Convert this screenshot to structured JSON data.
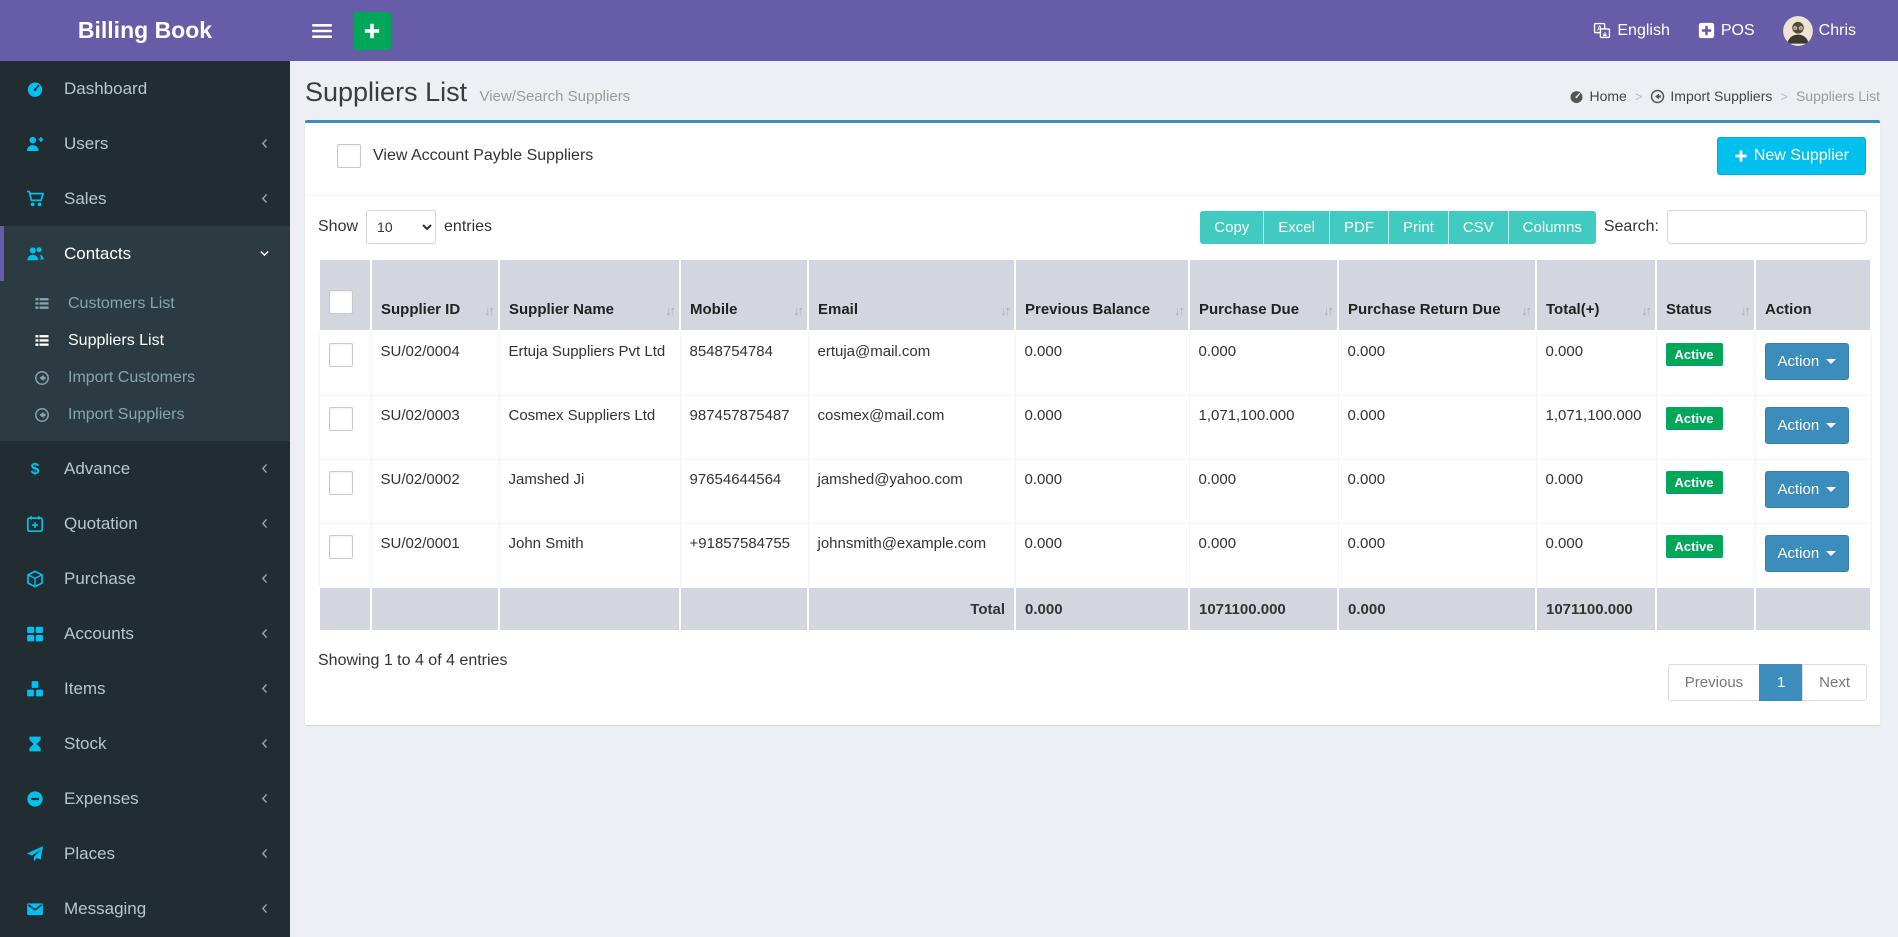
{
  "navbar": {
    "brand": "Billing Book",
    "language_label": "English",
    "pos_label": "POS",
    "user_name": "Chris"
  },
  "sidebar": {
    "items": [
      {
        "label": "Dashboard",
        "icon": "dashboard-icon"
      },
      {
        "label": "Users",
        "icon": "user-plus-icon"
      },
      {
        "label": "Sales",
        "icon": "cart-icon"
      },
      {
        "label": "Contacts",
        "icon": "users-icon"
      },
      {
        "label": "Advance",
        "icon": "dollar-icon"
      },
      {
        "label": "Quotation",
        "icon": "calendar-plus-icon"
      },
      {
        "label": "Purchase",
        "icon": "cube-icon"
      },
      {
        "label": "Accounts",
        "icon": "grid-icon"
      },
      {
        "label": "Items",
        "icon": "cubes-icon"
      },
      {
        "label": "Stock",
        "icon": "hourglass-icon"
      },
      {
        "label": "Expenses",
        "icon": "minus-circle-icon"
      },
      {
        "label": "Places",
        "icon": "paper-plane-icon"
      },
      {
        "label": "Messaging",
        "icon": "envelope-icon"
      }
    ],
    "submenu": [
      {
        "label": "Customers List",
        "icon": "list-icon",
        "active": false
      },
      {
        "label": "Suppliers List",
        "icon": "list-icon",
        "active": true
      },
      {
        "label": "Import Customers",
        "icon": "arrow-circle-icon",
        "active": false
      },
      {
        "label": "Import Suppliers",
        "icon": "arrow-circle-icon",
        "active": false
      }
    ]
  },
  "page": {
    "title": "Suppliers List",
    "subtitle": "View/Search Suppliers",
    "breadcrumb": {
      "home": "Home",
      "middle": "Import Suppliers",
      "current": "Suppliers List"
    }
  },
  "panel": {
    "filter_checkbox_label": "View Account Payble Suppliers",
    "new_supplier_label": "New Supplier",
    "show_label": "Show",
    "page_size": "10",
    "entries_label": "entries",
    "export_buttons": [
      "Copy",
      "Excel",
      "PDF",
      "Print",
      "CSV",
      "Columns"
    ],
    "search_label": "Search:",
    "search_value": ""
  },
  "table": {
    "columns": [
      {
        "label": "Supplier ID"
      },
      {
        "label": "Supplier Name"
      },
      {
        "label": "Mobile"
      },
      {
        "label": "Email"
      },
      {
        "label": "Previous Balance"
      },
      {
        "label": "Purchase Due"
      },
      {
        "label": "Purchase Return Due"
      },
      {
        "label": "Total(+)"
      },
      {
        "label": "Status"
      },
      {
        "label": "Action"
      }
    ],
    "rows": [
      {
        "id": "SU/02/0004",
        "name": "Ertuja Suppliers Pvt Ltd",
        "mobile": "8548754784",
        "email": "ertuja@mail.com",
        "previous_balance": "0.000",
        "purchase_due": "0.000",
        "purchase_return_due": "0.000",
        "total": "0.000",
        "status": "Active",
        "action_label": "Action"
      },
      {
        "id": "SU/02/0003",
        "name": "Cosmex Suppliers Ltd",
        "mobile": "987457875487",
        "email": "cosmex@mail.com",
        "previous_balance": "0.000",
        "purchase_due": "1,071,100.000",
        "purchase_return_due": "0.000",
        "total": "1,071,100.000",
        "status": "Active",
        "action_label": "Action"
      },
      {
        "id": "SU/02/0002",
        "name": "Jamshed Ji",
        "mobile": "97654644564",
        "email": "jamshed@yahoo.com",
        "previous_balance": "0.000",
        "purchase_due": "0.000",
        "purchase_return_due": "0.000",
        "total": "0.000",
        "status": "Active",
        "action_label": "Action"
      },
      {
        "id": "SU/02/0001",
        "name": "John Smith",
        "mobile": "+91857584755",
        "email": "johnsmith@example.com",
        "previous_balance": "0.000",
        "purchase_due": "0.000",
        "purchase_return_due": "0.000",
        "total": "0.000",
        "status": "Active",
        "action_label": "Action"
      }
    ],
    "total_row": {
      "label": "Total",
      "previous_balance": "0.000",
      "purchase_due": "1071100.000",
      "purchase_return_due": "0.000",
      "total": "1071100.000"
    }
  },
  "footer": {
    "showing_text": "Showing 1 to 4 of 4 entries",
    "pagination": {
      "previous": "Previous",
      "current_page": "1",
      "next": "Next"
    }
  },
  "colors": {
    "navbar_purple": "#665ca8",
    "sidebar_dark": "#222d32",
    "sidebar_icon_cyan": "#00c0ef",
    "panel_top_border": "#3c8dbc",
    "new_supplier_cyan": "#00c0ef",
    "export_teal": "#41cac0",
    "status_green": "#00a65a",
    "action_blue": "#3c8dbc",
    "header_gray": "#d3d6de"
  }
}
